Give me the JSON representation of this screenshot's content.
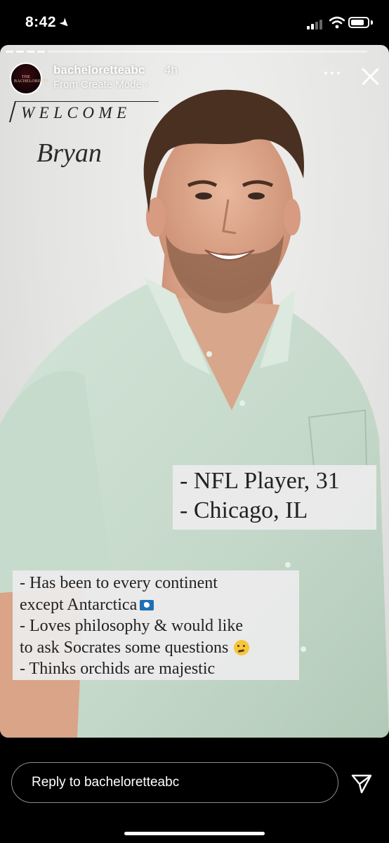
{
  "status_bar": {
    "time": "8:42",
    "location_arrow": "➤",
    "battery_level_percent": 80
  },
  "story": {
    "progress_segments": 4,
    "account": {
      "username": "bacheloretteabc",
      "time_ago": "4h",
      "subtitle": "From Create Mode ›",
      "avatar_text": "THE BACHELORETTE"
    },
    "welcome": "WELCOME",
    "name": "Bryan",
    "stats": [
      "- NFL Player, 31",
      "- Chicago, IL"
    ],
    "facts": [
      "- Has been to every continent",
      "except Antarctica",
      "- Loves philosophy & would like",
      "to ask Socrates some questions",
      "- Thinks orchids are majestic"
    ]
  },
  "reply": {
    "placeholder": "Reply to bacheloretteabc"
  },
  "icons": {
    "more": "more-icon",
    "close": "close-icon",
    "send": "send-icon",
    "flag": "antarctica-flag-icon",
    "thinking": "thinking-face-icon"
  },
  "colors": {
    "background": "#000000",
    "story_bg": "#e8e8e7",
    "shirt": "#c9dccf",
    "caption_box": "#ebebeb",
    "caption_text": "#222222"
  }
}
